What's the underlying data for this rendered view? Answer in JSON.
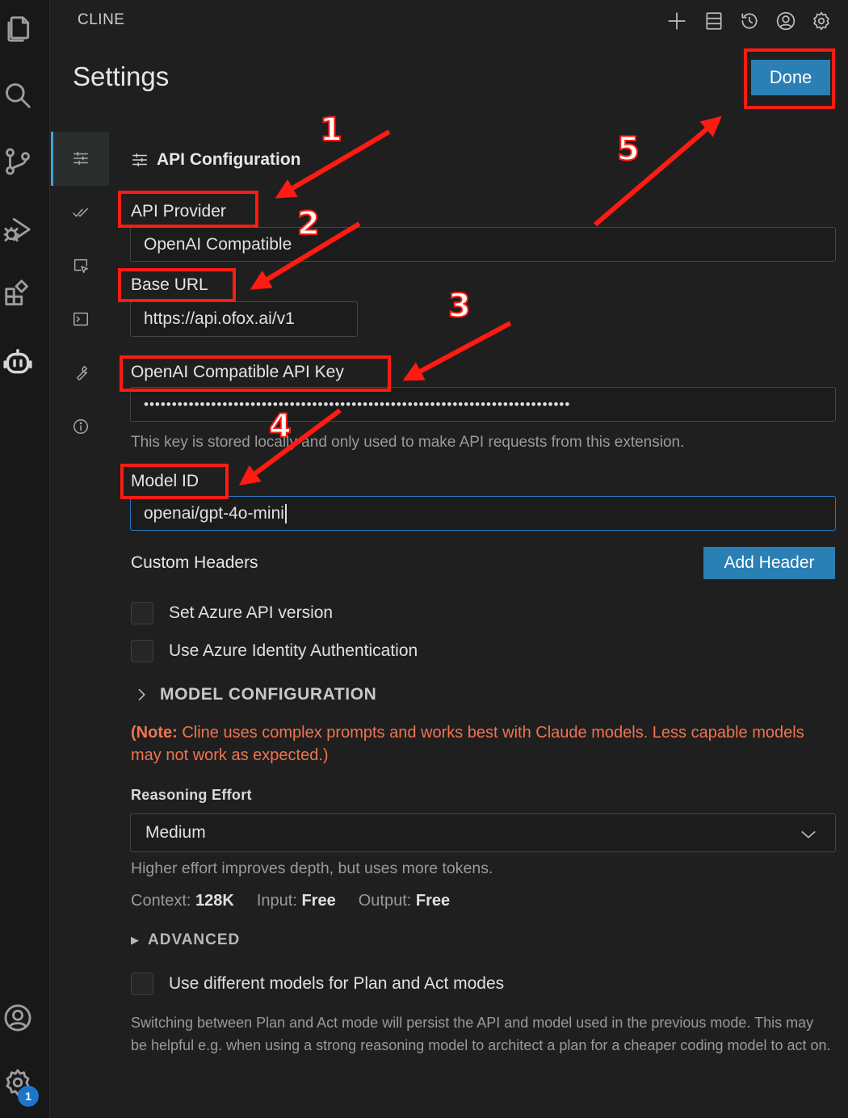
{
  "header": {
    "app_title": "CLINE",
    "page_title": "Settings",
    "done_label": "Done"
  },
  "section": {
    "title": "API Configuration"
  },
  "fields": {
    "api_provider_label": "API Provider",
    "api_provider_value": "OpenAI Compatible",
    "base_url_label": "Base URL",
    "base_url_value": "https://api.ofox.ai/v1",
    "api_key_label": "OpenAI Compatible API Key",
    "api_key_value": "••••••••••••••••••••••••••••••••••••••••••••••••••••••••••••••••••••••••••••",
    "api_key_hint": "This key is stored locally and only used to make API requests from this extension.",
    "model_id_label": "Model ID",
    "model_id_value": "openai/gpt-4o-mini"
  },
  "custom_headers": {
    "label": "Custom Headers",
    "add_label": "Add Header"
  },
  "checkboxes": {
    "azure_version": "Set Azure API version",
    "azure_identity": "Use Azure Identity Authentication",
    "plan_act": "Use different models for Plan and Act modes"
  },
  "model_config": {
    "title": "MODEL CONFIGURATION",
    "note_bold": "(Note:",
    "note_rest": " Cline uses complex prompts and works best with Claude models. Less capable models may not work as expected.)",
    "reasoning_label": "Reasoning Effort",
    "reasoning_value": "Medium",
    "reasoning_hint": "Higher effort improves depth, but uses more tokens.",
    "context_label": "Context:",
    "context_value": "128K",
    "input_label": "Input:",
    "input_value": "Free",
    "output_label": "Output:",
    "output_value": "Free"
  },
  "advanced": {
    "title": "ADVANCED",
    "plan_act_desc": "Switching between Plan and Act mode will persist the API and model used in the previous mode. This may be helpful e.g. when using a strong reasoning model to architect a plan for a cheaper coding model to act on."
  },
  "activity_bar": {
    "settings_badge": "1"
  },
  "annotations": {
    "n1": "1",
    "n2": "2",
    "n3": "3",
    "n4": "4",
    "n5": "5",
    "color": "#ff1b12"
  }
}
